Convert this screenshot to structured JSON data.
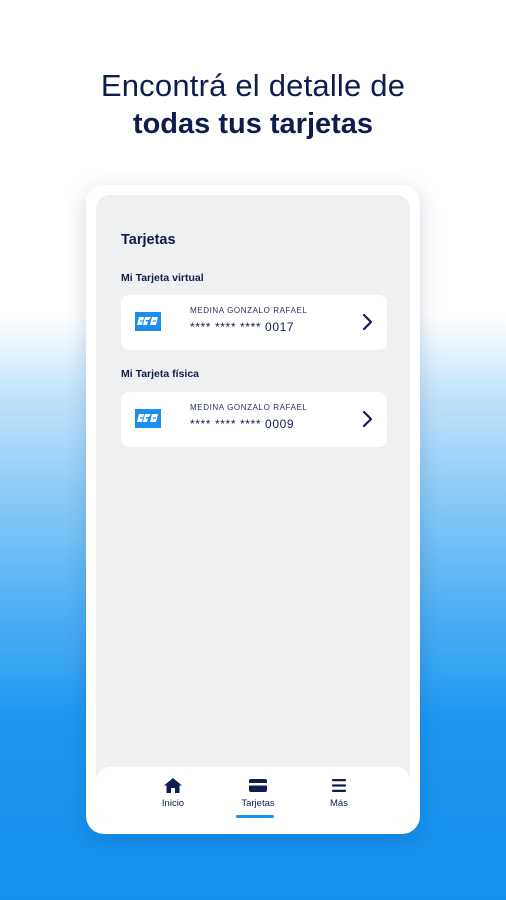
{
  "headline": {
    "line1": "Encontrá el detalle de",
    "line2": "todas tus tarjetas"
  },
  "screen": {
    "title": "Tarjetas",
    "virtual_section": {
      "label": "Mi Tarjeta virtual",
      "card": {
        "holder": "MEDINA GONZALO RAFAEL",
        "number": "**** **** **** 0017",
        "logo_icon": "card-brand-logo-icon",
        "action_icon": "chevron-right-icon"
      }
    },
    "physical_section": {
      "label": "Mi Tarjeta física",
      "card": {
        "holder": "MEDINA GONZALO RAFAEL",
        "number": "**** **** **** 0009",
        "logo_icon": "card-brand-logo-icon",
        "action_icon": "chevron-right-icon"
      }
    }
  },
  "nav": {
    "items": [
      {
        "label": "Inicio",
        "icon": "home-icon",
        "active": false
      },
      {
        "label": "Tarjetas",
        "icon": "card-icon",
        "active": true
      },
      {
        "label": "Más",
        "icon": "menu-icon",
        "active": false
      }
    ]
  },
  "colors": {
    "navy": "#0e1d4d",
    "accent_blue": "#1991ee",
    "screen_bg": "#eef0f1"
  }
}
